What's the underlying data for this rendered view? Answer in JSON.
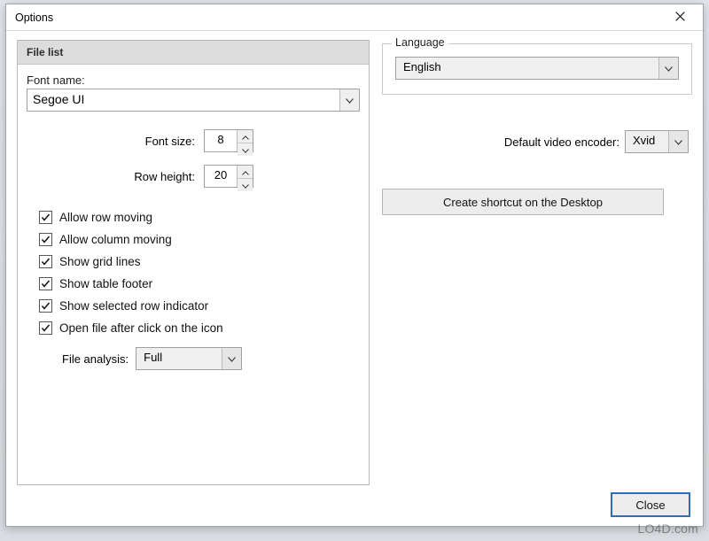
{
  "window": {
    "title": "Options"
  },
  "left": {
    "header": "File list",
    "font_name_label": "Font name:",
    "font_name_value": "Segoe UI",
    "font_size_label": "Font size:",
    "font_size_value": "8",
    "row_height_label": "Row height:",
    "row_height_value": "20",
    "checks": [
      "Allow row moving",
      "Allow column moving",
      "Show grid lines",
      "Show table footer",
      "Show selected row indicator",
      "Open file after click on the icon"
    ],
    "file_analysis_label": "File analysis:",
    "file_analysis_value": "Full"
  },
  "right": {
    "language_legend": "Language",
    "language_value": "English",
    "encoder_label": "Default video encoder:",
    "encoder_value": "Xvid",
    "shortcut_label": "Create shortcut on the Desktop"
  },
  "buttons": {
    "close": "Close"
  },
  "watermark": "LO4D.com"
}
